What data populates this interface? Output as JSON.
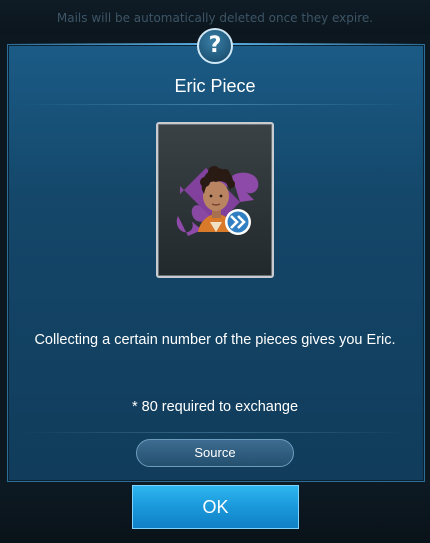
{
  "background_hint": "Mails will be automatically deleted once they expire.",
  "help_icon": "question-mark-icon",
  "title": "Eric Piece",
  "item": {
    "icon": "puzzle-piece-icon",
    "badge_icon": "double-chevron-right-icon"
  },
  "description": "Collecting a certain number of the pieces gives you Eric.",
  "requirement": "* 80 required to exchange",
  "source_label": "Source",
  "ok_label": "OK",
  "colors": {
    "panel": "#14476a",
    "ok_button": "#1a98db",
    "puzzle": "#8e4aa8"
  }
}
